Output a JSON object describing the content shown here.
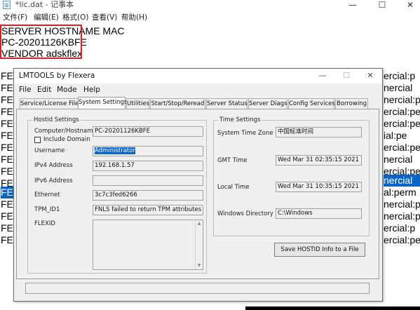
{
  "notepad": {
    "title": "*lic.dat - 记事本",
    "controls": {
      "minimize": "—",
      "maximize": "☐",
      "close": "✕"
    },
    "menu": [
      "文件(F)",
      "编辑(E)",
      "格式(O)",
      "查看(V)",
      "帮助(H)"
    ],
    "lines": [
      "SERVER HOSTNAME MAC",
      "PC-20201126KBFE",
      "VENDOR adskflex"
    ],
    "left_fragments": [
      "FEA",
      "FEA",
      "FEA",
      "FEA",
      "FEA",
      "FEA",
      "FEA",
      "FEA",
      "FEA",
      "FEA",
      "FEA",
      "FEA",
      "FEA",
      "FEA",
      "FEA"
    ],
    "right_fragments": [
      "ercial:p",
      "nercial",
      "nercial:pe",
      "ercial:pe",
      "ercial:pe",
      "ial:pe",
      "ercial:pe",
      "nercial",
      "ercial:pe",
      "nercial",
      "al:perm",
      "nercial:p",
      "nercial:pe",
      "ercial:p",
      "ercial:pe"
    ]
  },
  "lmtools": {
    "title": "LMTOOLS by Flexera",
    "controls": {
      "minimize": "—",
      "maximize": "☐",
      "close": "✕"
    },
    "menu": {
      "file": "File",
      "edit": "Edit",
      "mode": "Mode",
      "help": "Help"
    },
    "tabs": [
      "Service/License File",
      "System Settings",
      "Utilities",
      "Start/Stop/Reread",
      "Server Status",
      "Server Diags",
      "Config Services",
      "Borrowing"
    ],
    "selected_tab": "System Settings",
    "hostid": {
      "group_title": "Hostid Settings",
      "computer_label": "Computer/Hostname",
      "computer_value": "PC-20201126KBFE",
      "include_domain": "Include Domain",
      "username_label": "Username",
      "username_value": "Administrator",
      "ipv4_label": "IPv4 Address",
      "ipv4_value": "192.168.1.57",
      "ipv6_label": "IPv6 Address",
      "ipv6_value": "",
      "ethernet_label": "Ethernet",
      "ethernet_value": "3c7c3fed6266",
      "tpm_label": "TPM_ID1",
      "tpm_value": "FNLS failed to return TPM attributes",
      "flexid_label": "FLEXID"
    },
    "time": {
      "group_title": "Time Settings",
      "tz_label": "System Time Zone",
      "tz_value": "中国标准时间",
      "gmt_label": "GMT Time",
      "gmt_value": "Wed Mar 31 02:35:15 2021",
      "local_label": "Local Time",
      "local_value": "Wed Mar 31 10:35:15 2021",
      "windir_label": "Windows Directory",
      "windir_value": "C:\\Windows"
    },
    "save_button": "Save HOSTID Info to a File",
    "status_text": ""
  }
}
